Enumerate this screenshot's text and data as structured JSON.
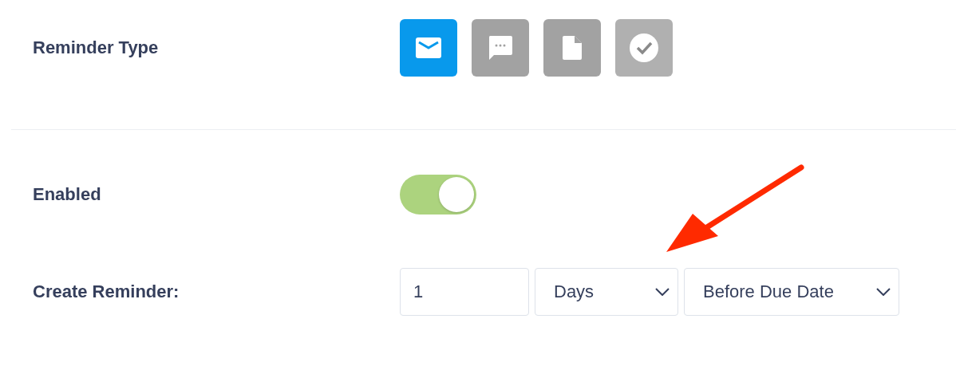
{
  "reminder_type": {
    "label": "Reminder Type",
    "options": [
      {
        "kind": "email",
        "selected": true,
        "disabled": false
      },
      {
        "kind": "message",
        "selected": false,
        "disabled": false
      },
      {
        "kind": "document",
        "selected": false,
        "disabled": false
      },
      {
        "kind": "check",
        "selected": false,
        "disabled": true
      }
    ]
  },
  "enabled": {
    "label": "Enabled",
    "on": true
  },
  "create_reminder": {
    "label": "Create Reminder:",
    "amount": "1",
    "unit": "Days",
    "timing": "Before Due Date"
  }
}
